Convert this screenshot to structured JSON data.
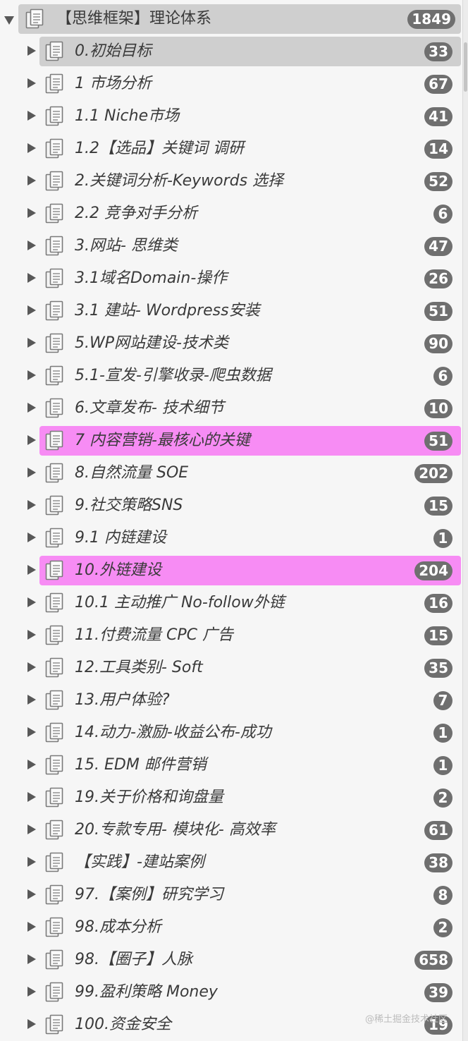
{
  "outline": {
    "root": {
      "label": "【思维框架】理论体系",
      "count": "1849"
    },
    "items": [
      {
        "label": "0.初始目标",
        "count": "33",
        "state": "selected"
      },
      {
        "label": "1 市场分析",
        "count": "67"
      },
      {
        "label": "1.1 Niche市场",
        "count": "41"
      },
      {
        "label": "1.2【选品】关键词 调研",
        "count": "14"
      },
      {
        "label": "2.关键词分析-Keywords 选择",
        "count": "52"
      },
      {
        "label": "2.2 竞争对手分析",
        "count": "6"
      },
      {
        "label": "3.网站- 思维类",
        "count": "47"
      },
      {
        "label": "3.1域名Domain-操作",
        "count": "26"
      },
      {
        "label": "3.1 建站- Wordpress安装",
        "count": "51"
      },
      {
        "label": "5.WP网站建设-技术类",
        "count": "90"
      },
      {
        "label": "5.1-宣发-引擎收录-爬虫数据",
        "count": "6"
      },
      {
        "label": "6.文章发布- 技术细节",
        "count": "10"
      },
      {
        "label": "7 内容营销-最核心的关键",
        "count": "51",
        "state": "pink"
      },
      {
        "label": "8.自然流量 SOE",
        "count": "202"
      },
      {
        "label": "9.社交策略SNS",
        "count": "15"
      },
      {
        "label": "9.1 内链建设",
        "count": "1"
      },
      {
        "label": "10.外链建设",
        "count": "204",
        "state": "pink"
      },
      {
        "label": "10.1 主动推广 No-follow外链",
        "count": "16"
      },
      {
        "label": "11.付费流量 CPC 广告",
        "count": "15"
      },
      {
        "label": "12.工具类别- Soft",
        "count": "35"
      },
      {
        "label": "13.用户体验?",
        "count": "7"
      },
      {
        "label": "14.动力-激励-收益公布-成功",
        "count": "1"
      },
      {
        "label": "15. EDM 邮件营销",
        "count": "1"
      },
      {
        "label": "19.关于价格和询盘量",
        "count": "2"
      },
      {
        "label": "20.专款专用- 模块化- 高效率",
        "count": "61"
      },
      {
        "label": "【实践】-建站案例",
        "count": "38"
      },
      {
        "label": "97.【案例】研究学习",
        "count": "8"
      },
      {
        "label": "98.成本分析",
        "count": "2"
      },
      {
        "label": "98.【圈子】人脉",
        "count": "658"
      },
      {
        "label": "99.盈利策略 Money",
        "count": "39"
      },
      {
        "label": "100.资金安全",
        "count": "19"
      }
    ]
  },
  "watermark": "@稀土掘金技术社区",
  "colors": {
    "selected_bg": "#cfcfcf",
    "highlight_pink": "#f78cf4",
    "badge_bg": "#6f6f6f",
    "text": "#3a3a3a"
  },
  "icons": {
    "disclosure_open": "triangle-down",
    "disclosure_closed": "triangle-right",
    "item": "document-stack"
  }
}
